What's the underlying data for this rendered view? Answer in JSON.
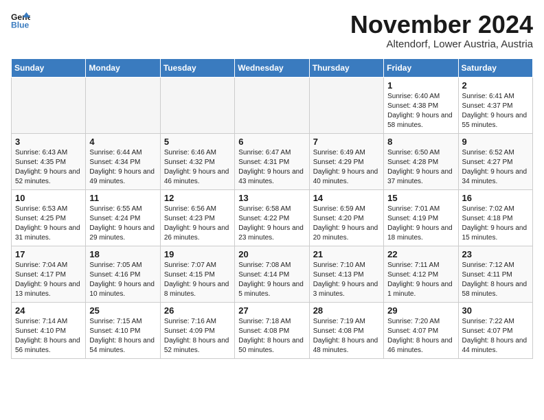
{
  "header": {
    "logo_line1": "General",
    "logo_line2": "Blue",
    "month": "November 2024",
    "location": "Altendorf, Lower Austria, Austria"
  },
  "weekdays": [
    "Sunday",
    "Monday",
    "Tuesday",
    "Wednesday",
    "Thursday",
    "Friday",
    "Saturday"
  ],
  "weeks": [
    [
      {
        "day": "",
        "sunrise": "",
        "sunset": "",
        "daylight": ""
      },
      {
        "day": "",
        "sunrise": "",
        "sunset": "",
        "daylight": ""
      },
      {
        "day": "",
        "sunrise": "",
        "sunset": "",
        "daylight": ""
      },
      {
        "day": "",
        "sunrise": "",
        "sunset": "",
        "daylight": ""
      },
      {
        "day": "",
        "sunrise": "",
        "sunset": "",
        "daylight": ""
      },
      {
        "day": "1",
        "sunrise": "Sunrise: 6:40 AM",
        "sunset": "Sunset: 4:38 PM",
        "daylight": "Daylight: 9 hours and 58 minutes."
      },
      {
        "day": "2",
        "sunrise": "Sunrise: 6:41 AM",
        "sunset": "Sunset: 4:37 PM",
        "daylight": "Daylight: 9 hours and 55 minutes."
      }
    ],
    [
      {
        "day": "3",
        "sunrise": "Sunrise: 6:43 AM",
        "sunset": "Sunset: 4:35 PM",
        "daylight": "Daylight: 9 hours and 52 minutes."
      },
      {
        "day": "4",
        "sunrise": "Sunrise: 6:44 AM",
        "sunset": "Sunset: 4:34 PM",
        "daylight": "Daylight: 9 hours and 49 minutes."
      },
      {
        "day": "5",
        "sunrise": "Sunrise: 6:46 AM",
        "sunset": "Sunset: 4:32 PM",
        "daylight": "Daylight: 9 hours and 46 minutes."
      },
      {
        "day": "6",
        "sunrise": "Sunrise: 6:47 AM",
        "sunset": "Sunset: 4:31 PM",
        "daylight": "Daylight: 9 hours and 43 minutes."
      },
      {
        "day": "7",
        "sunrise": "Sunrise: 6:49 AM",
        "sunset": "Sunset: 4:29 PM",
        "daylight": "Daylight: 9 hours and 40 minutes."
      },
      {
        "day": "8",
        "sunrise": "Sunrise: 6:50 AM",
        "sunset": "Sunset: 4:28 PM",
        "daylight": "Daylight: 9 hours and 37 minutes."
      },
      {
        "day": "9",
        "sunrise": "Sunrise: 6:52 AM",
        "sunset": "Sunset: 4:27 PM",
        "daylight": "Daylight: 9 hours and 34 minutes."
      }
    ],
    [
      {
        "day": "10",
        "sunrise": "Sunrise: 6:53 AM",
        "sunset": "Sunset: 4:25 PM",
        "daylight": "Daylight: 9 hours and 31 minutes."
      },
      {
        "day": "11",
        "sunrise": "Sunrise: 6:55 AM",
        "sunset": "Sunset: 4:24 PM",
        "daylight": "Daylight: 9 hours and 29 minutes."
      },
      {
        "day": "12",
        "sunrise": "Sunrise: 6:56 AM",
        "sunset": "Sunset: 4:23 PM",
        "daylight": "Daylight: 9 hours and 26 minutes."
      },
      {
        "day": "13",
        "sunrise": "Sunrise: 6:58 AM",
        "sunset": "Sunset: 4:22 PM",
        "daylight": "Daylight: 9 hours and 23 minutes."
      },
      {
        "day": "14",
        "sunrise": "Sunrise: 6:59 AM",
        "sunset": "Sunset: 4:20 PM",
        "daylight": "Daylight: 9 hours and 20 minutes."
      },
      {
        "day": "15",
        "sunrise": "Sunrise: 7:01 AM",
        "sunset": "Sunset: 4:19 PM",
        "daylight": "Daylight: 9 hours and 18 minutes."
      },
      {
        "day": "16",
        "sunrise": "Sunrise: 7:02 AM",
        "sunset": "Sunset: 4:18 PM",
        "daylight": "Daylight: 9 hours and 15 minutes."
      }
    ],
    [
      {
        "day": "17",
        "sunrise": "Sunrise: 7:04 AM",
        "sunset": "Sunset: 4:17 PM",
        "daylight": "Daylight: 9 hours and 13 minutes."
      },
      {
        "day": "18",
        "sunrise": "Sunrise: 7:05 AM",
        "sunset": "Sunset: 4:16 PM",
        "daylight": "Daylight: 9 hours and 10 minutes."
      },
      {
        "day": "19",
        "sunrise": "Sunrise: 7:07 AM",
        "sunset": "Sunset: 4:15 PM",
        "daylight": "Daylight: 9 hours and 8 minutes."
      },
      {
        "day": "20",
        "sunrise": "Sunrise: 7:08 AM",
        "sunset": "Sunset: 4:14 PM",
        "daylight": "Daylight: 9 hours and 5 minutes."
      },
      {
        "day": "21",
        "sunrise": "Sunrise: 7:10 AM",
        "sunset": "Sunset: 4:13 PM",
        "daylight": "Daylight: 9 hours and 3 minutes."
      },
      {
        "day": "22",
        "sunrise": "Sunrise: 7:11 AM",
        "sunset": "Sunset: 4:12 PM",
        "daylight": "Daylight: 9 hours and 1 minute."
      },
      {
        "day": "23",
        "sunrise": "Sunrise: 7:12 AM",
        "sunset": "Sunset: 4:11 PM",
        "daylight": "Daylight: 8 hours and 58 minutes."
      }
    ],
    [
      {
        "day": "24",
        "sunrise": "Sunrise: 7:14 AM",
        "sunset": "Sunset: 4:10 PM",
        "daylight": "Daylight: 8 hours and 56 minutes."
      },
      {
        "day": "25",
        "sunrise": "Sunrise: 7:15 AM",
        "sunset": "Sunset: 4:10 PM",
        "daylight": "Daylight: 8 hours and 54 minutes."
      },
      {
        "day": "26",
        "sunrise": "Sunrise: 7:16 AM",
        "sunset": "Sunset: 4:09 PM",
        "daylight": "Daylight: 8 hours and 52 minutes."
      },
      {
        "day": "27",
        "sunrise": "Sunrise: 7:18 AM",
        "sunset": "Sunset: 4:08 PM",
        "daylight": "Daylight: 8 hours and 50 minutes."
      },
      {
        "day": "28",
        "sunrise": "Sunrise: 7:19 AM",
        "sunset": "Sunset: 4:08 PM",
        "daylight": "Daylight: 8 hours and 48 minutes."
      },
      {
        "day": "29",
        "sunrise": "Sunrise: 7:20 AM",
        "sunset": "Sunset: 4:07 PM",
        "daylight": "Daylight: 8 hours and 46 minutes."
      },
      {
        "day": "30",
        "sunrise": "Sunrise: 7:22 AM",
        "sunset": "Sunset: 4:07 PM",
        "daylight": "Daylight: 8 hours and 44 minutes."
      }
    ]
  ]
}
